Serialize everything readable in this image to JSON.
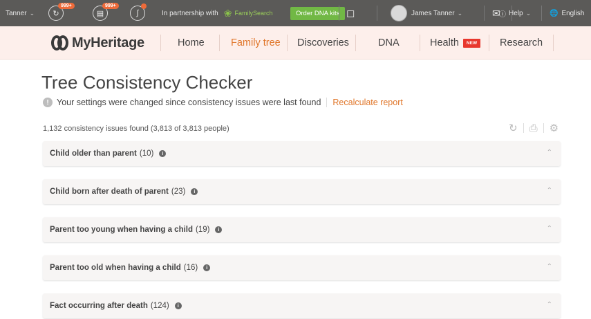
{
  "topbar": {
    "user_name": "Tanner",
    "badge1": "999+",
    "badge2": "999+",
    "partnership_text": "In partnership with",
    "familysearch": "FamilySearch",
    "order_btn": "Order DNA kits",
    "account_name": "James Tanner",
    "help": "Help",
    "language": "English",
    "icons": [
      "chevron-down-icon",
      "sync-icon",
      "doc-icon",
      "dna-icon",
      "cart-icon",
      "mail-icon",
      "help-icon",
      "globe-icon"
    ]
  },
  "nav": {
    "brand": "MyHeritage",
    "items": [
      {
        "label": "Home"
      },
      {
        "label": "Family tree"
      },
      {
        "label": "Discoveries"
      },
      {
        "label": "DNA"
      },
      {
        "label": "Health"
      },
      {
        "label": "Research"
      }
    ],
    "active_item": "Family tree",
    "health_badge": "NEW",
    "accent": "#e0762a"
  },
  "main": {
    "title": "Tree Consistency Checker",
    "notice": "Your settings were changed since consistency issues were last found",
    "recalc_label": "Recalculate report",
    "summary": "1,132 consistency issues found (3,813 of 3,813 people)",
    "tool_icons": [
      "refresh-icon",
      "print-icon",
      "settings-icon"
    ],
    "issues": [
      {
        "name": "Child older than parent",
        "count": "(10)"
      },
      {
        "name": "Child born after death of parent",
        "count": "(23)"
      },
      {
        "name": "Parent too young when having a child",
        "count": "(19)"
      },
      {
        "name": "Parent too old when having a child",
        "count": "(16)"
      },
      {
        "name": "Fact occurring after death",
        "count": "(124)"
      }
    ]
  }
}
